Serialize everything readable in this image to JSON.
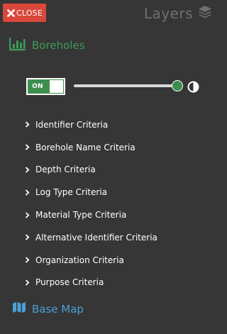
{
  "close_button": {
    "label": "CLOSE"
  },
  "header": {
    "title": "Layers"
  },
  "boreholes": {
    "label": "Boreholes",
    "toggle_state": "ON",
    "opacity": 1.0
  },
  "criteria": [
    {
      "label": "Identifier Criteria"
    },
    {
      "label": "Borehole Name Criteria"
    },
    {
      "label": "Depth Criteria"
    },
    {
      "label": "Log Type Criteria"
    },
    {
      "label": "Material Type Criteria"
    },
    {
      "label": "Alternative Identifier Criteria"
    },
    {
      "label": "Organization Criteria"
    },
    {
      "label": "Purpose Criteria"
    }
  ],
  "base_map": {
    "label": "Base Map"
  },
  "icons": {
    "close": "close-icon",
    "layers": "layers-icon",
    "boreholes": "bar-chart-icon",
    "contrast": "contrast-icon",
    "chevron": "chevron-right-icon",
    "base_map": "map-icon"
  },
  "colors": {
    "background": "#363636",
    "close": "#d9483a",
    "accent_green": "#3e8e4e",
    "boreholes_label": "#3e9b57",
    "base_map": "#4ba0d8",
    "header_muted": "#6f6f6f"
  }
}
